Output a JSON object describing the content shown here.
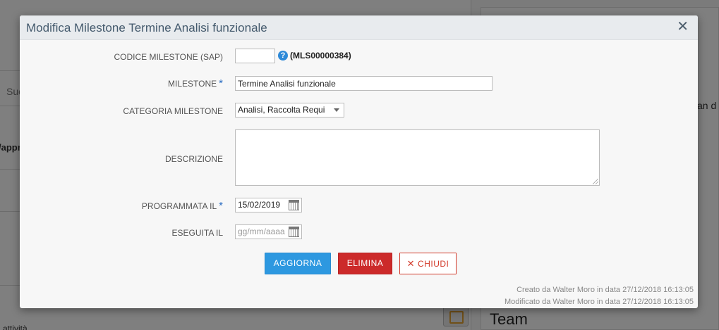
{
  "background": {
    "left_texts": [
      "Suc",
      "/appr",
      "i attività"
    ],
    "right_text": "an d",
    "team_label": "Team"
  },
  "modal": {
    "title": "Modifica Milestone Termine Analisi funzionale",
    "close_icon": "close-icon",
    "fields": {
      "codice_label": "CODICE MILESTONE (SAP)",
      "codice_value": "",
      "codice_code": "(MLS00000384)",
      "help_icon": "?",
      "milestone_label": "MILESTONE",
      "milestone_value": "Termine Analisi funzionale",
      "categoria_label": "CATEGORIA MILESTONE",
      "categoria_value": "Analisi, Raccolta Requi",
      "descrizione_label": "DESCRIZIONE",
      "descrizione_value": "",
      "programmata_label": "PROGRAMMATA IL",
      "programmata_value": "15/02/2019",
      "eseguita_label": "ESEGUITA IL",
      "eseguita_placeholder": "gg/mm/aaaa",
      "required_mark": "*"
    },
    "buttons": {
      "update": "AGGIORNA",
      "delete": "ELIMINA",
      "close": "CHIUDI",
      "close_icon_glyph": "✕"
    },
    "footer": {
      "created": "Creato da Walter Moro in data 27/12/2018 16:13:05",
      "modified": "Modificato da Walter Moro in data 27/12/2018 16:13:05"
    }
  },
  "colors": {
    "primary": "#2d98e0",
    "danger": "#cc2a2a",
    "title": "#445a6d"
  }
}
